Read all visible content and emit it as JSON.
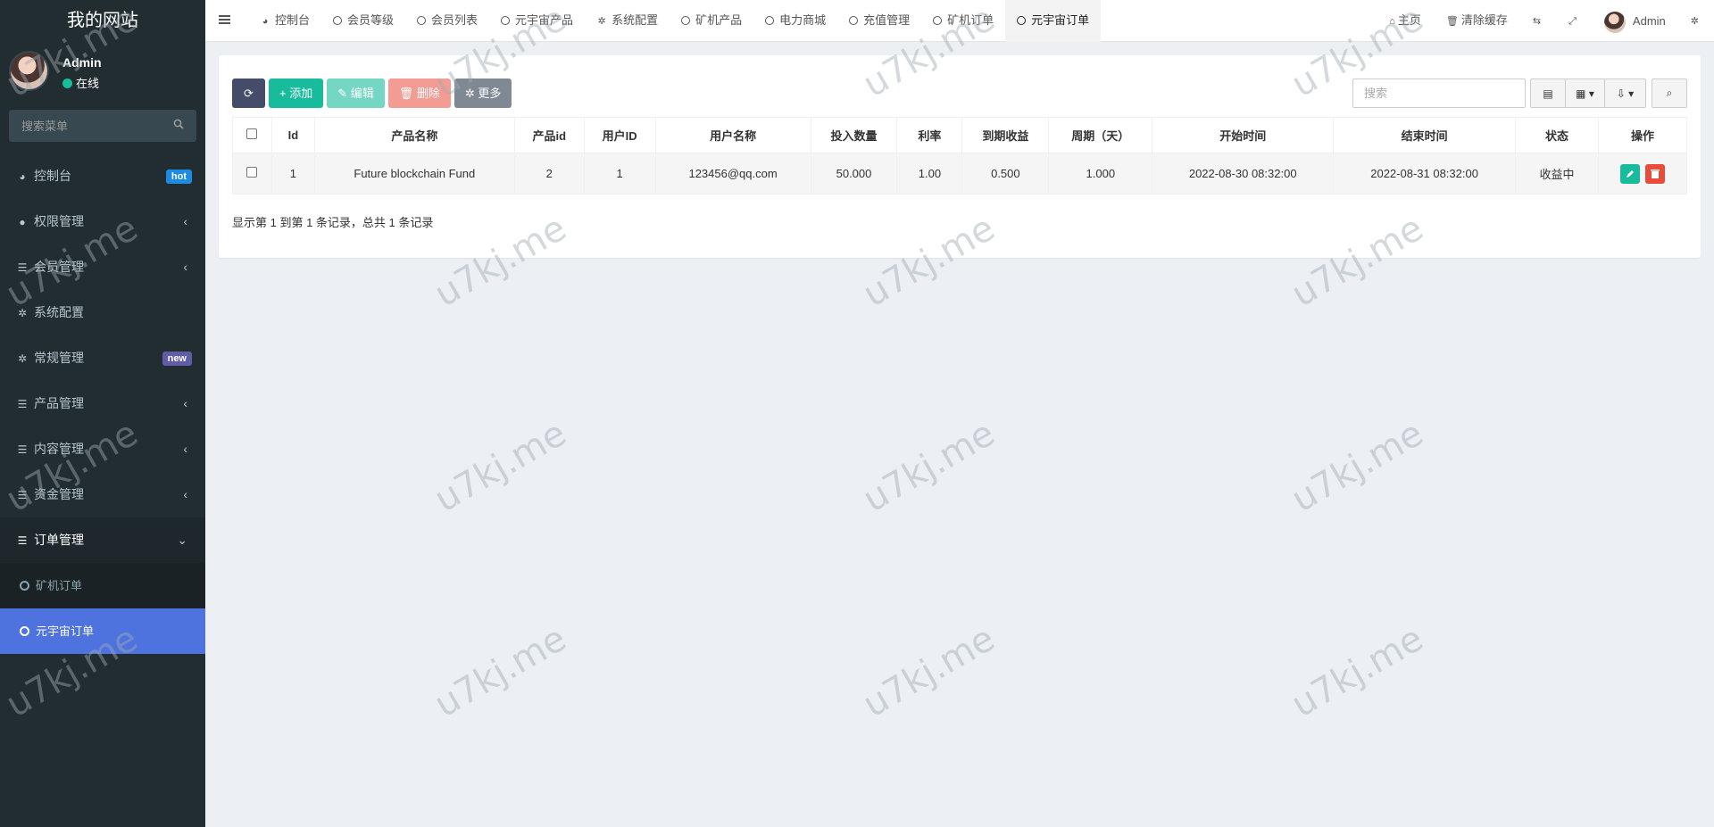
{
  "sidebar": {
    "logo": "我的网站",
    "user": {
      "name": "Admin",
      "status": "在线"
    },
    "search_placeholder": "搜索菜单",
    "items": [
      {
        "label": "控制台",
        "badge": "hot"
      },
      {
        "label": "权限管理"
      },
      {
        "label": "会员管理"
      },
      {
        "label": "系统配置"
      },
      {
        "label": "常规管理",
        "badge": "new"
      },
      {
        "label": "产品管理"
      },
      {
        "label": "内容管理"
      },
      {
        "label": "资金管理"
      },
      {
        "label": "订单管理"
      }
    ],
    "sub_items": [
      {
        "label": "矿机订单"
      },
      {
        "label": "元宇宙订单"
      }
    ]
  },
  "topnav": {
    "tabs": [
      {
        "label": "控制台",
        "icon": "dashboard-icon"
      },
      {
        "label": "会员等级",
        "icon": "circle-icon"
      },
      {
        "label": "会员列表",
        "icon": "circle-icon"
      },
      {
        "label": "元宇宙产品",
        "icon": "circle-icon"
      },
      {
        "label": "系统配置",
        "icon": "gear-icon"
      },
      {
        "label": "矿机产品",
        "icon": "circle-icon"
      },
      {
        "label": "电力商城",
        "icon": "circle-icon"
      },
      {
        "label": "充值管理",
        "icon": "circle-icon"
      },
      {
        "label": "矿机订单",
        "icon": "circle-icon"
      },
      {
        "label": "元宇宙订单",
        "icon": "circle-icon"
      }
    ],
    "right": {
      "home": "主页",
      "clear_cache": "清除缓存",
      "user": "Admin"
    }
  },
  "toolbar": {
    "add": "添加",
    "edit": "编辑",
    "delete": "删除",
    "more": "更多",
    "search_placeholder": "搜索"
  },
  "table": {
    "headers": [
      "Id",
      "产品名称",
      "产品id",
      "用户ID",
      "用户名称",
      "投入数量",
      "利率",
      "到期收益",
      "周期（天）",
      "开始时间",
      "结束时间",
      "状态",
      "操作"
    ],
    "rows": [
      [
        "1",
        "Future blockchain Fund",
        "2",
        "1",
        "123456@qq.com",
        "50.000",
        "1.00",
        "0.500",
        "1.000",
        "2022-08-30 08:32:00",
        "2022-08-31 08:32:00",
        "收益中"
      ]
    ],
    "summary": "显示第 1 到第 1 条记录，总共 1 条记录"
  },
  "watermark": "u7kj.me",
  "colors": {
    "sidebar_bg": "#222d32",
    "accent": "#4e73df",
    "success": "#18bc9c",
    "danger": "#e74c3c"
  }
}
